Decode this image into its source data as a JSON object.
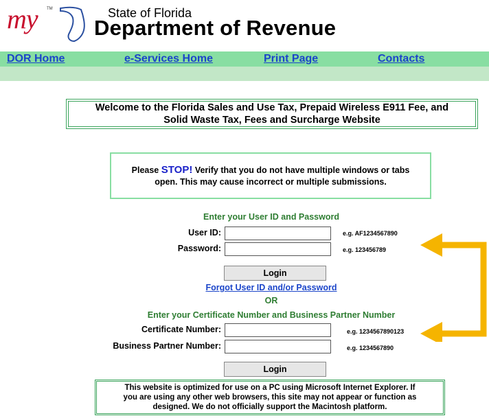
{
  "header": {
    "logo_text": "my",
    "logo_tm": "TM",
    "state": "State of Florida",
    "department": "Department of Revenue"
  },
  "nav": {
    "dor_home": "DOR Home",
    "eservices_home": "e-Services Home",
    "print_page": "Print Page",
    "contacts": "Contacts"
  },
  "welcome": {
    "line1": "Welcome to the Florida Sales and Use Tax, Prepaid Wireless E911 Fee, and",
    "line2": "Solid Waste Tax, Fees and Surcharge Website"
  },
  "stop_notice": {
    "please": "Please",
    "stop": "STOP!",
    "rest_line1": "Verify that you do not have multiple windows or tabs",
    "line2": "open. This may cause incorrect or multiple submissions."
  },
  "login_userid": {
    "heading": "Enter your User ID and Password",
    "user_id_label": "User ID:",
    "user_id_example": "e.g. AF1234567890",
    "password_label": "Password:",
    "password_example": "e.g. 123456789",
    "login_label": "Login",
    "forgot_link": "Forgot User ID and/or Password"
  },
  "or_text": "OR",
  "login_cert": {
    "heading": "Enter your Certificate Number and Business Partner Number",
    "cert_label": "Certificate Number:",
    "cert_example": "e.g. 1234567890123",
    "bp_label": "Business Partner Number:",
    "bp_example": "e.g. 1234567890",
    "login_label": "Login"
  },
  "browser_note": {
    "line1": "This website is optimized for use on a PC using Microsoft Internet Explorer. If",
    "line2": "you are using any other web browsers, this site may not appear or function as",
    "line3": "designed. We do not officially support the Macintosh platform."
  },
  "colors": {
    "nav_bar": "#88dea2",
    "nav_sub": "#c2e7c7",
    "link_blue": "#1b45c9",
    "heading_green": "#2e7d32",
    "arrow_orange": "#f5b400",
    "logo_red": "#c8102e"
  }
}
